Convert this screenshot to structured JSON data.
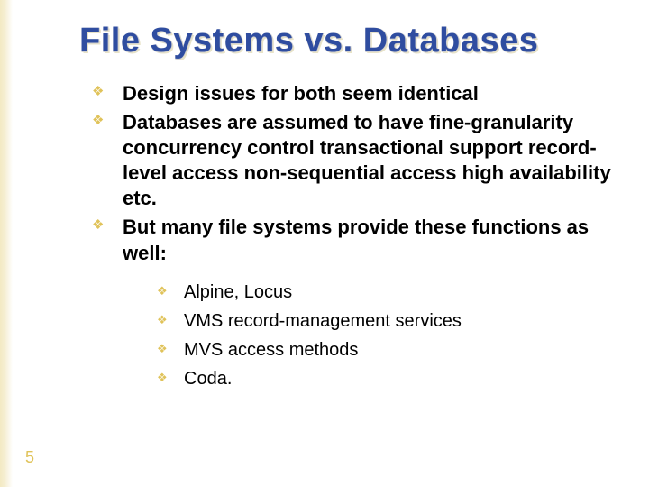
{
  "title": "File Systems vs. Databases",
  "bullets": {
    "level1": [
      "Design issues for both seem identical",
      "Databases are assumed to have fine-granularity concurrency control  transactional support record-level access non-sequential access high availability etc.",
      "But many file systems provide these functions as well:"
    ],
    "level2": [
      "Alpine, Locus",
      "VMS record-management services",
      "MVS access methods",
      "Coda."
    ]
  },
  "page_number": "5"
}
